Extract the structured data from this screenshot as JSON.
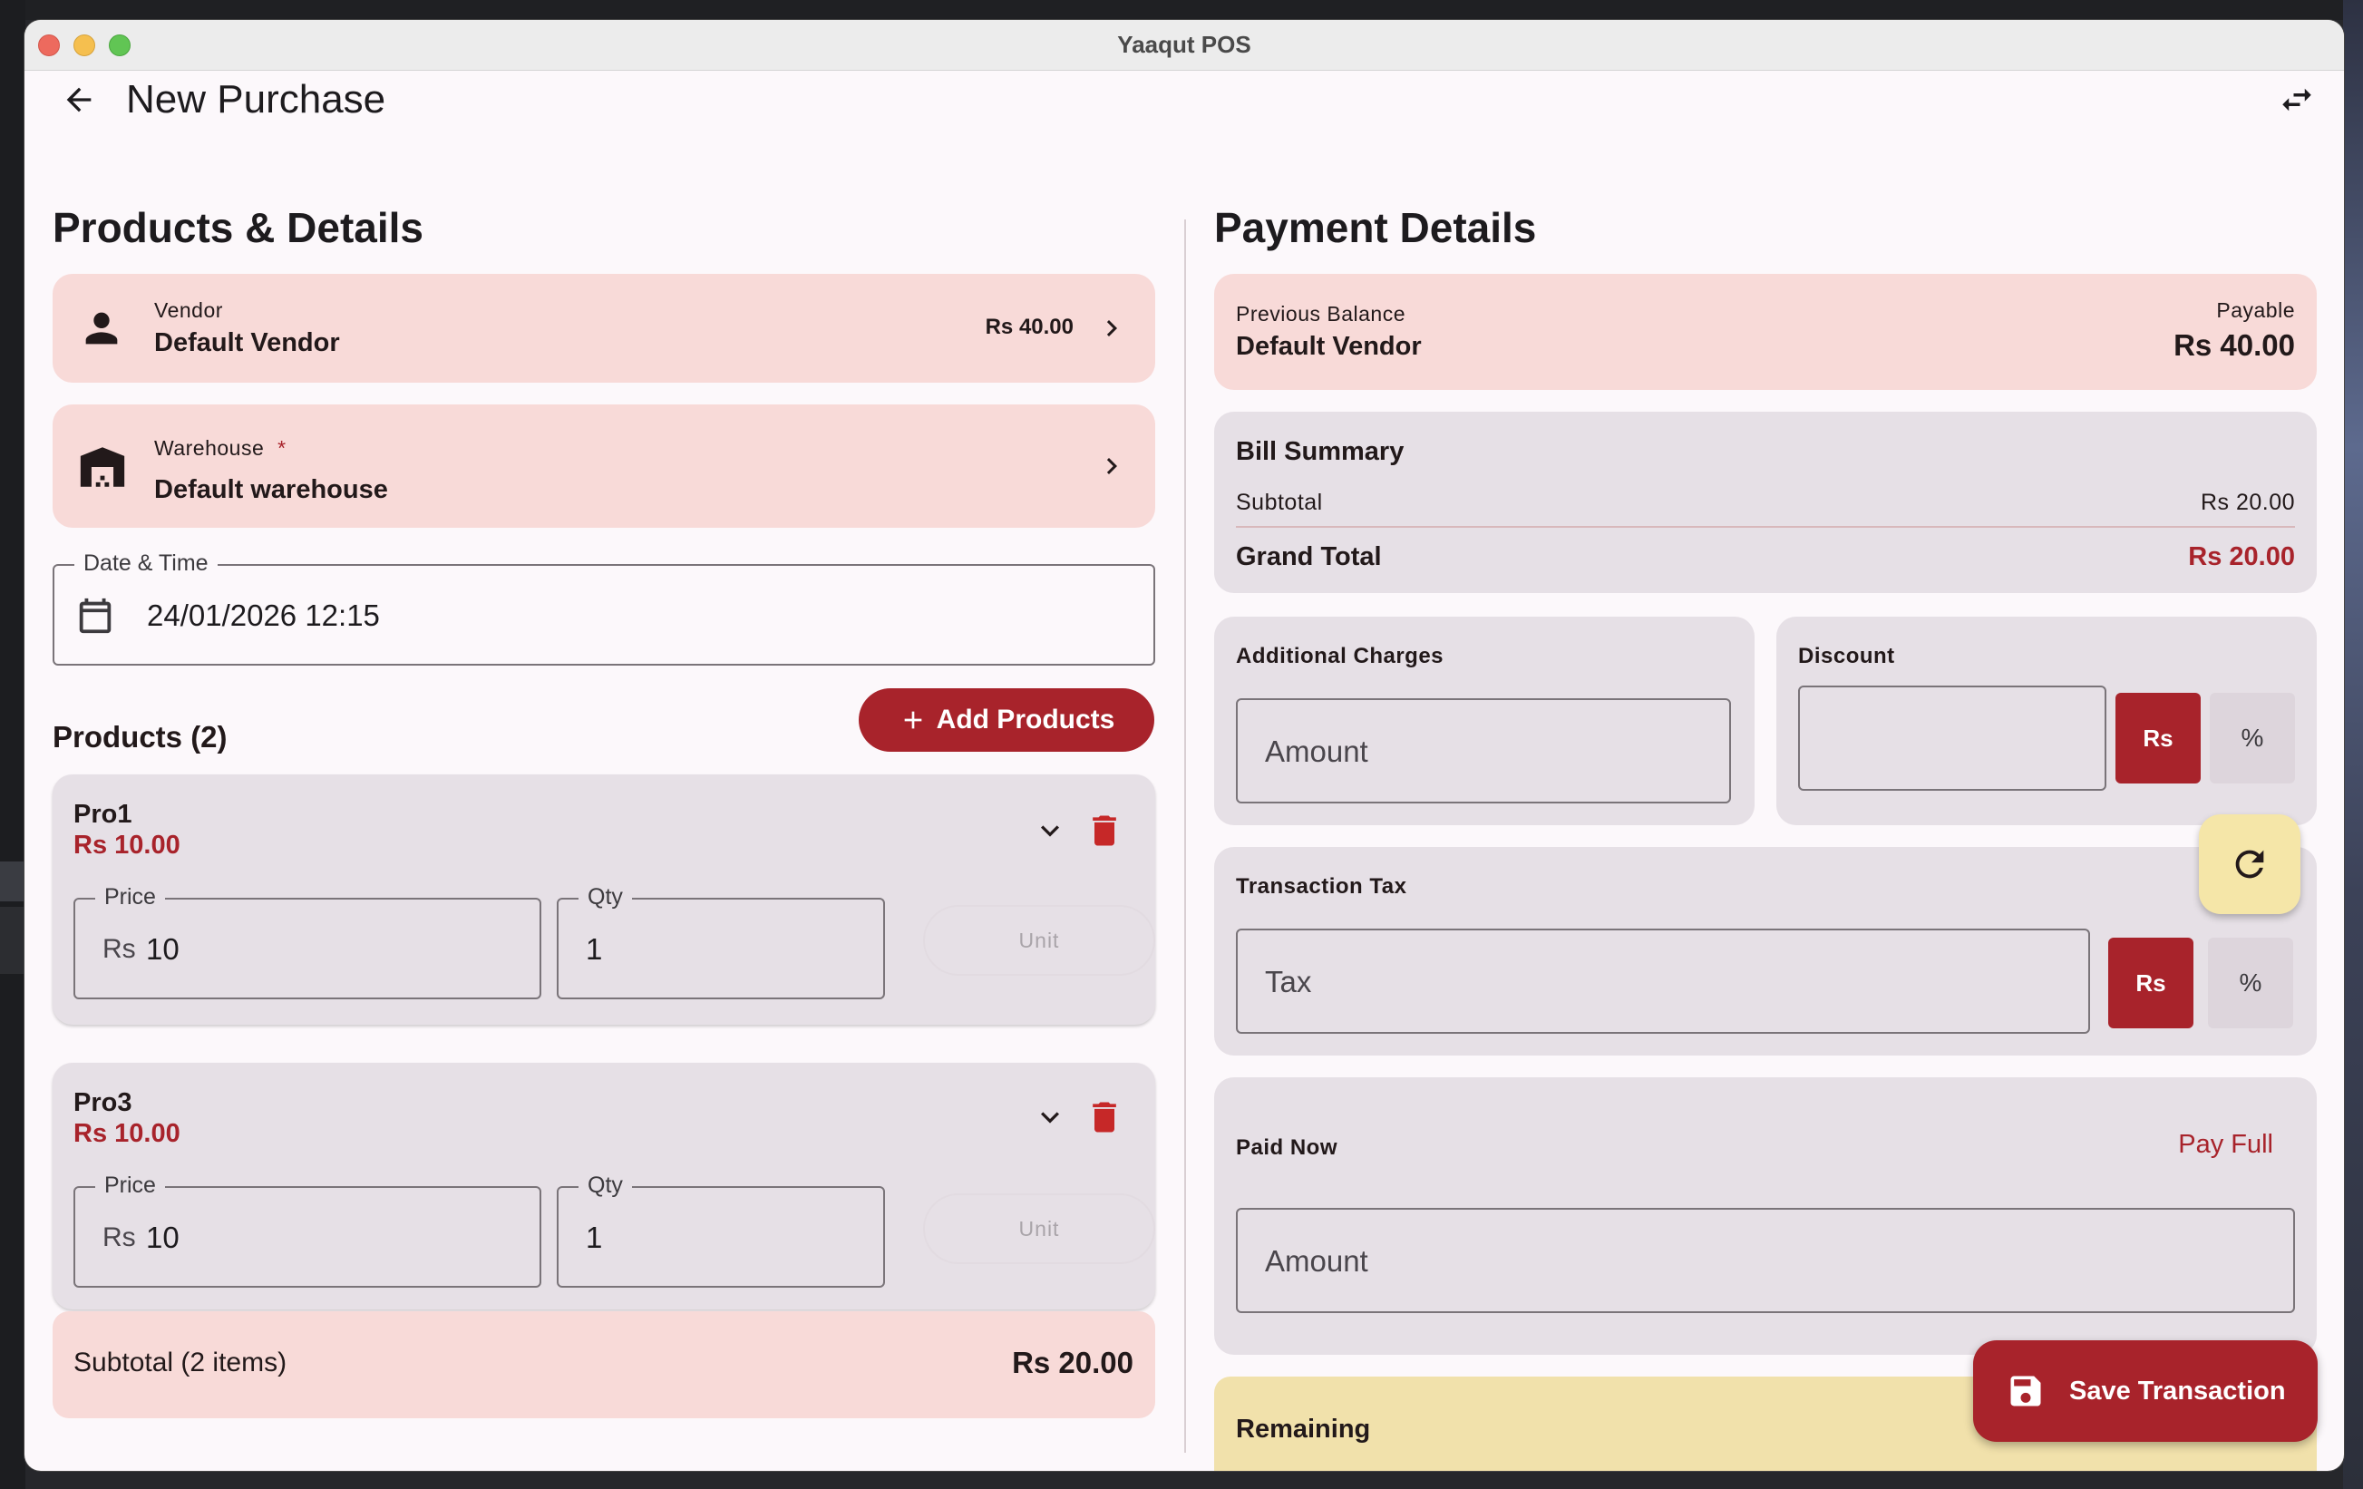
{
  "window": {
    "title": "Yaaqut POS"
  },
  "header": {
    "title": "New Purchase"
  },
  "left": {
    "section_title": "Products & Details",
    "vendor": {
      "label": "Vendor",
      "name": "Default Vendor",
      "balance": "Rs 40.00"
    },
    "warehouse": {
      "label": "Warehouse",
      "required_mark": "*",
      "name": "Default warehouse"
    },
    "datetime": {
      "label": "Date & Time",
      "value": "24/01/2026 12:15"
    },
    "products_heading": "Products (2)",
    "add_products_label": "Add Products",
    "products": [
      {
        "name": "Pro1",
        "price_display": "Rs 10.00",
        "price_label": "Price",
        "currency": "Rs",
        "price_value": "10",
        "qty_label": "Qty",
        "qty_value": "1",
        "unit_label": "Unit"
      },
      {
        "name": "Pro3",
        "price_display": "Rs 10.00",
        "price_label": "Price",
        "currency": "Rs",
        "price_value": "10",
        "qty_label": "Qty",
        "qty_value": "1",
        "unit_label": "Unit"
      }
    ],
    "subtotal": {
      "label": "Subtotal (2 items)",
      "value": "Rs 20.00"
    }
  },
  "right": {
    "section_title": "Payment Details",
    "previous_balance": {
      "label": "Previous Balance",
      "vendor": "Default Vendor",
      "status": "Payable",
      "amount": "Rs 40.00"
    },
    "bill_summary": {
      "title": "Bill Summary",
      "subtotal_label": "Subtotal",
      "subtotal_value": "Rs 20.00",
      "grand_total_label": "Grand Total",
      "grand_total_value": "Rs 20.00"
    },
    "additional_charges": {
      "title": "Additional Charges",
      "placeholder": "Amount"
    },
    "discount": {
      "title": "Discount",
      "value": "",
      "rs_label": "Rs",
      "pct_label": "%"
    },
    "transaction_tax": {
      "title": "Transaction Tax",
      "placeholder": "Tax",
      "rs_label": "Rs",
      "pct_label": "%"
    },
    "paid_now": {
      "title": "Paid Now",
      "pay_full_label": "Pay Full",
      "placeholder": "Amount"
    },
    "remaining": {
      "label": "Remaining"
    },
    "save_label": "Save Transaction"
  },
  "colors": {
    "accent": "#a8232b",
    "pink_card": "#f8dad8",
    "grey_card": "#e6e0e6",
    "yellow_card": "#f1e1ab",
    "fab": "#f5e6a8"
  },
  "icons": [
    "back-arrow",
    "swap-horiz",
    "person",
    "warehouse",
    "calendar",
    "chevron-right",
    "chevron-down",
    "delete",
    "add",
    "refresh",
    "save"
  ]
}
